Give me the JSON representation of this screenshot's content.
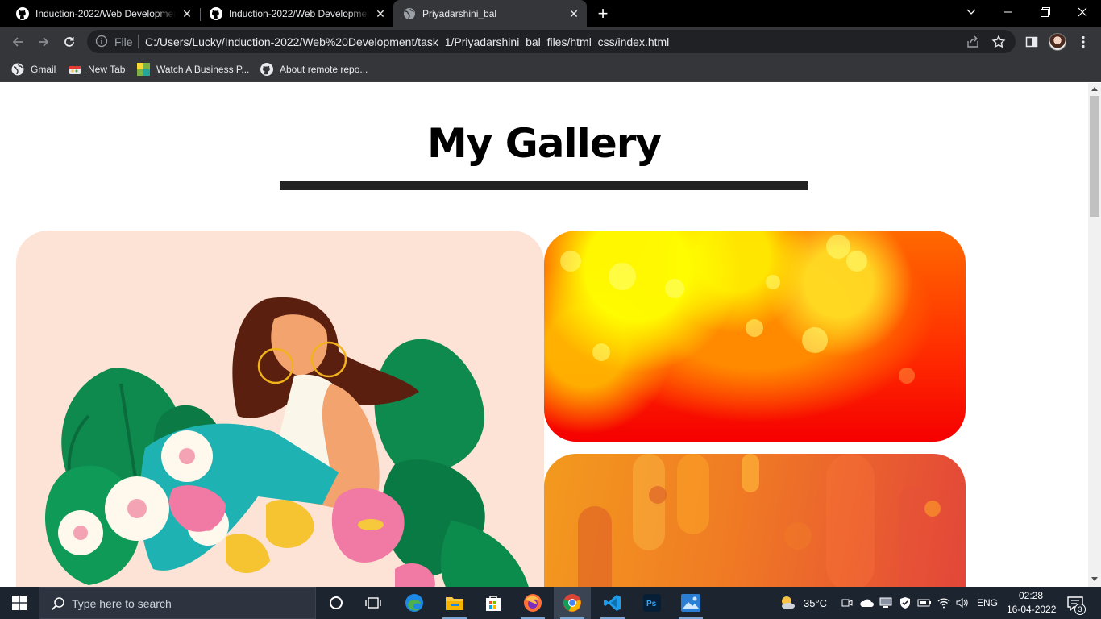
{
  "browser": {
    "tabs": [
      {
        "title": "Induction-2022/Web Development",
        "favicon": "github-icon",
        "active": false
      },
      {
        "title": "Induction-2022/Web Development",
        "favicon": "github-icon",
        "active": false
      },
      {
        "title": "Priyadarshini_bal",
        "favicon": "globe-icon",
        "active": true
      }
    ],
    "address": {
      "scheme_label": "File",
      "url": "C:/Users/Lucky/Induction-2022/Web%20Development/task_1/Priyadarshini_bal_files/html_css/index.html"
    },
    "bookmarks": [
      {
        "label": "Gmail",
        "icon": "globe-icon"
      },
      {
        "label": "New Tab",
        "icon": "newtab-icon"
      },
      {
        "label": "Watch A Business P...",
        "icon": "map-icon"
      },
      {
        "label": "About remote repo...",
        "icon": "github-icon"
      }
    ]
  },
  "page": {
    "heading": "My Gallery",
    "images": [
      {
        "name": "woman-plants-illustration"
      },
      {
        "name": "red-yellow-bokeh"
      },
      {
        "name": "orange-abstract-shapes"
      }
    ]
  },
  "taskbar": {
    "search_placeholder": "Type here to search",
    "apps": [
      "task-view-icon",
      "edge-icon",
      "file-explorer-icon",
      "store-icon",
      "firefox-icon",
      "chrome-icon",
      "vscode-icon",
      "photoshop-icon",
      "photos-icon"
    ],
    "weather": "35°C",
    "language": "ENG",
    "time": "02:28",
    "date": "16-04-2022",
    "notification_count": "3"
  },
  "colors": {
    "tab_bar": "#000000",
    "toolbar": "#35363a",
    "heading_rule": "#222222",
    "taskbar": "#1c2430"
  }
}
